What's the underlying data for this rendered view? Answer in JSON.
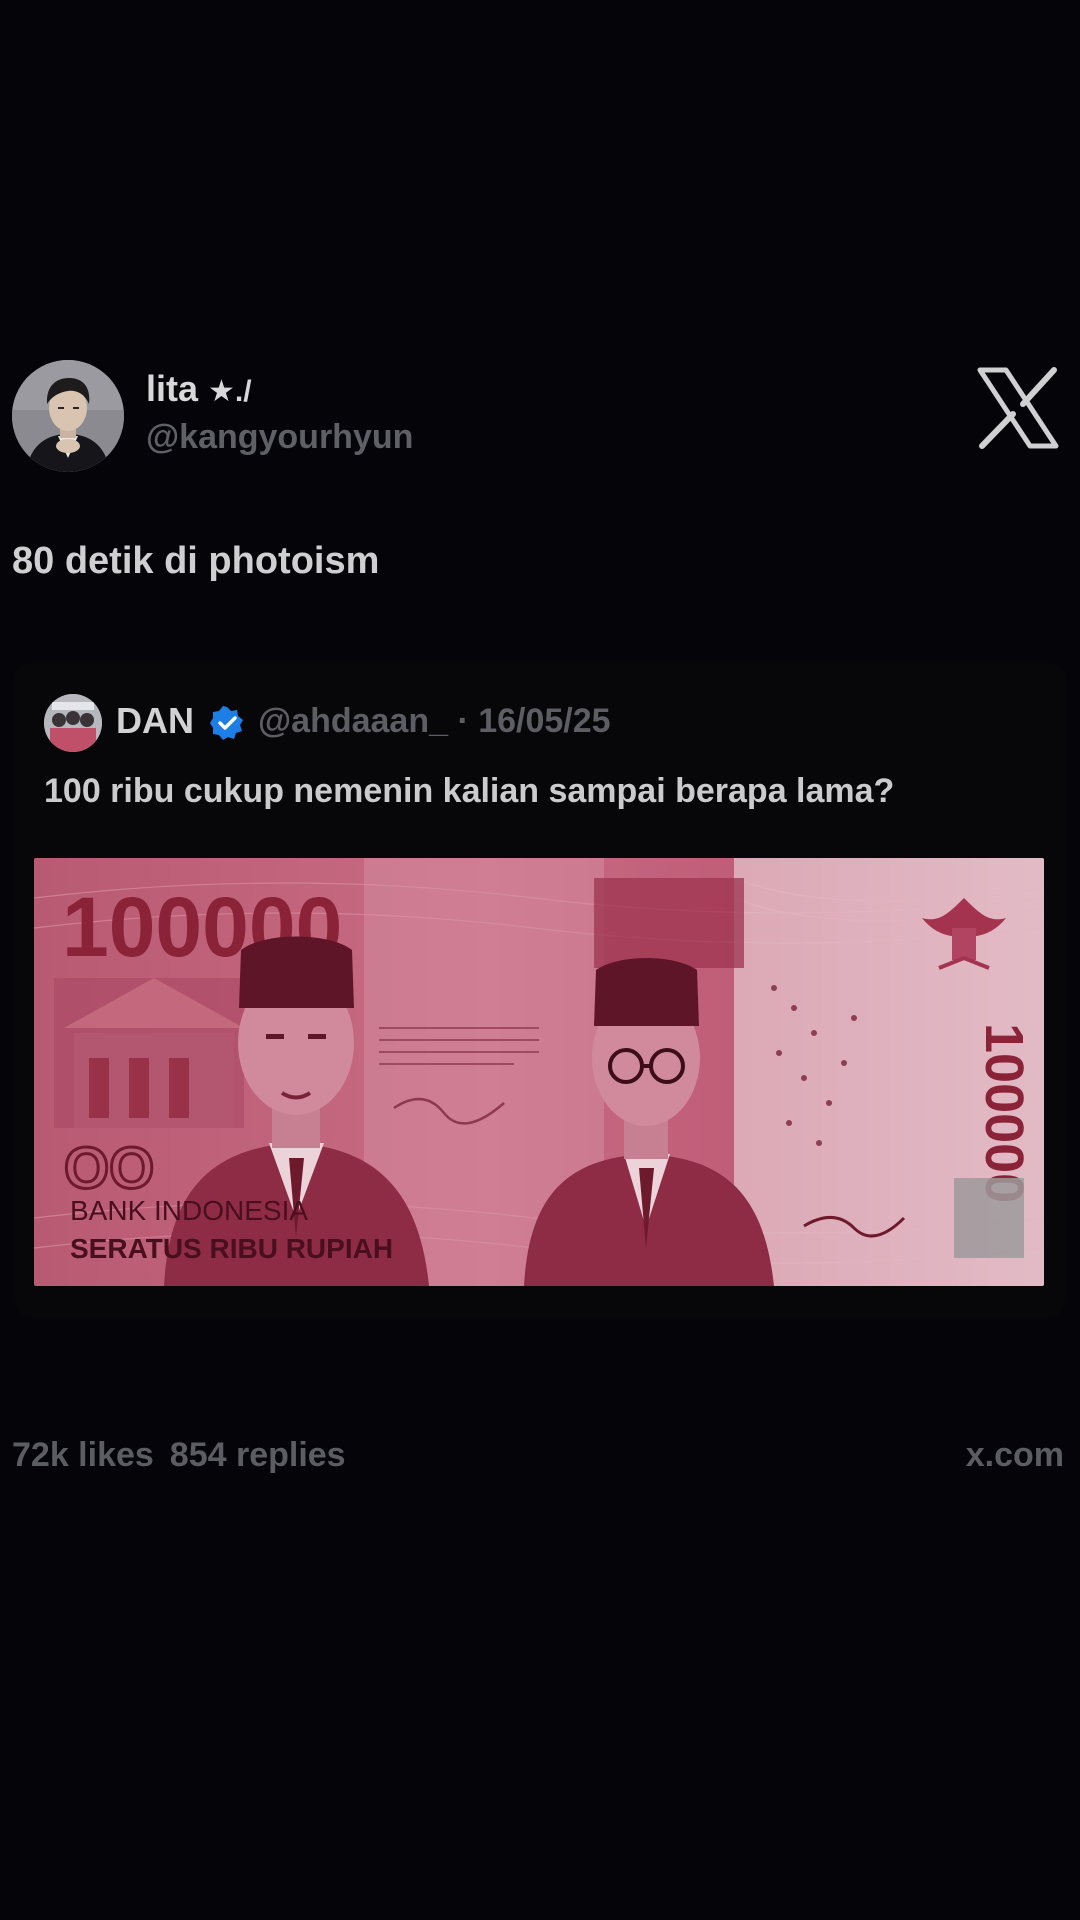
{
  "author": {
    "display_name": "lita",
    "name_decoration": "★./",
    "handle": "@kangyourhyun",
    "avatar_icon": "profile-photo-man-dark-suit",
    "platform_icon": "x-logo-icon"
  },
  "tweet": {
    "text": "80 detik di photoism"
  },
  "quoted_tweet": {
    "display_name": "DAN",
    "verified_icon": "verified-badge-icon",
    "handle": "@ahdaaan_",
    "separator": "·",
    "date": "16/05/25",
    "meta": "@ahdaaan_ · 16/05/25",
    "text": "100 ribu cukup nemenin kalian sampai berapa lama?",
    "image": {
      "alt_icon": "banknote-100000-rupiah",
      "denomination": "100000",
      "corner_mark": "OO",
      "bank_name": "BANK INDONESIA",
      "value_words": "SERATUS RIBU RUPIAH"
    }
  },
  "footer": {
    "likes": "72k likes",
    "replies": "854 replies",
    "site": "x.com"
  },
  "colors": {
    "background": "#050509",
    "text_primary": "#d8d8db",
    "text_muted": "#5f5f66",
    "verified_blue": "#1d7fe6",
    "note_pink": "#c4687e",
    "note_red": "#8e2438"
  }
}
